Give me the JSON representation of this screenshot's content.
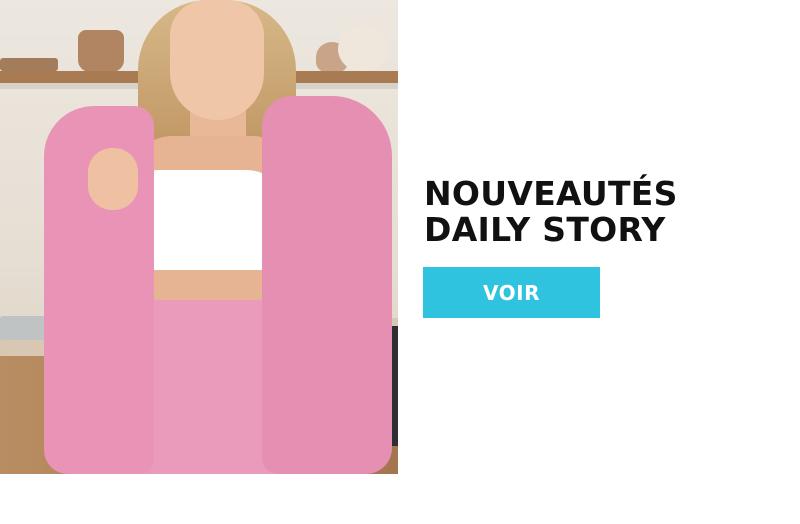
{
  "promo": {
    "headline_line1": "NOUVEAUTÉS",
    "headline_line2": "DAILY STORY",
    "cta_label": "VOIR"
  },
  "colors": {
    "cta_background": "#2fc3e0",
    "headline_text": "#111111",
    "background": "#ffffff",
    "outfit_accent": "#e994b6"
  }
}
